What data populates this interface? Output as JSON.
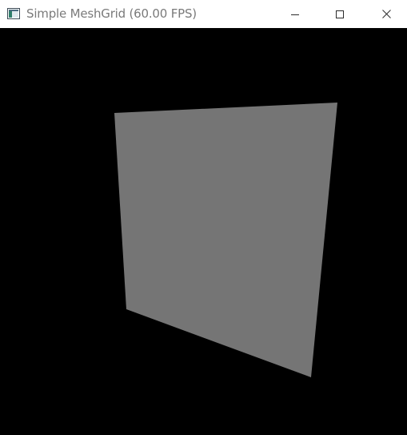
{
  "window": {
    "title": "Simple MeshGrid (60.00 FPS)",
    "icon": "app-window-icon",
    "controls": {
      "minimize_icon": "minimize-icon",
      "maximize_icon": "maximize-icon",
      "close_icon": "close-icon"
    }
  },
  "scene": {
    "background_color": "#000000",
    "mesh_color": "#757575",
    "object": "mesh-grid-plane"
  }
}
